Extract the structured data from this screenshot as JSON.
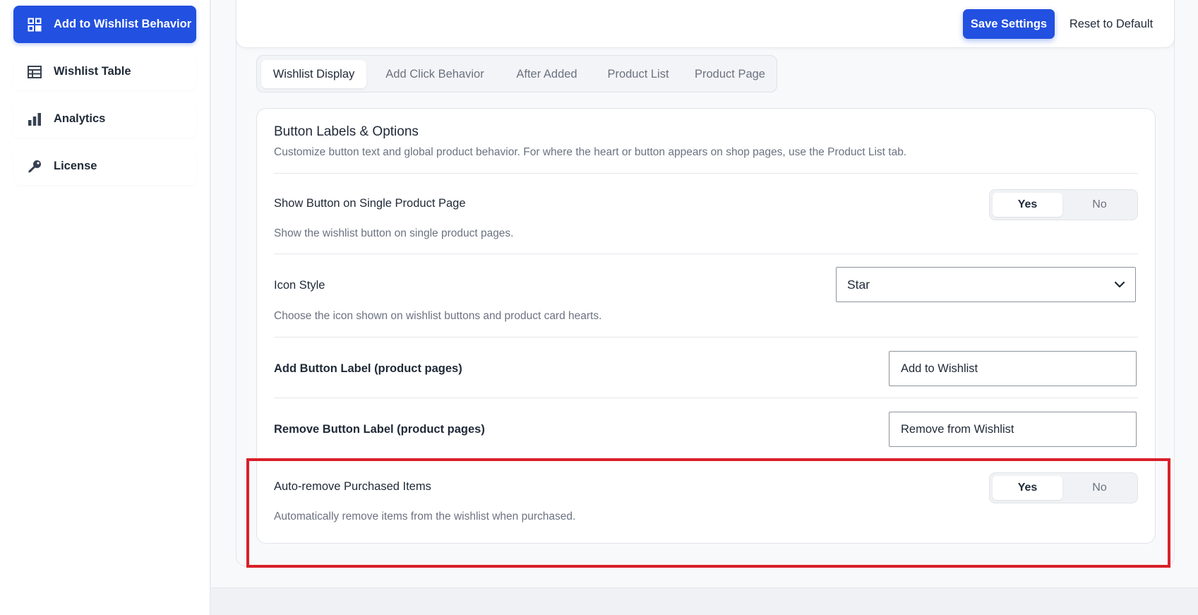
{
  "sidebar": {
    "items": [
      {
        "label": "Add to Wishlist Behavior",
        "icon": "grid-icon",
        "active": true
      },
      {
        "label": "Wishlist Table",
        "icon": "table-icon",
        "active": false
      },
      {
        "label": "Analytics",
        "icon": "bar-chart-icon",
        "active": false
      },
      {
        "label": "License",
        "icon": "key-icon",
        "active": false
      }
    ]
  },
  "toolbar": {
    "save_label": "Save Settings",
    "reset_label": "Reset to Default"
  },
  "tabs": [
    {
      "label": "Wishlist Display",
      "active": true
    },
    {
      "label": "Add Click Behavior",
      "active": false
    },
    {
      "label": "After Added",
      "active": false
    },
    {
      "label": "Product List",
      "active": false
    },
    {
      "label": "Product Page",
      "active": false
    }
  ],
  "section": {
    "title": "Button Labels & Options",
    "description": "Customize button text and global product behavior. For where the heart or button appears on shop pages, use the Product List tab."
  },
  "settings": {
    "show_button": {
      "label": "Show Button on Single Product Page",
      "description": "Show the wishlist button on single product pages.",
      "yes": "Yes",
      "no": "No",
      "value": "Yes"
    },
    "icon_style": {
      "label": "Icon Style",
      "description": "Choose the icon shown on wishlist buttons and product card hearts.",
      "value": "Star"
    },
    "add_label": {
      "label": "Add Button Label (product pages)",
      "value": "Add to Wishlist"
    },
    "remove_label": {
      "label": "Remove Button Label (product pages)",
      "value": "Remove from Wishlist"
    },
    "auto_remove": {
      "label": "Auto-remove Purchased Items",
      "description": "Automatically remove items from the wishlist when purchased.",
      "yes": "Yes",
      "no": "No",
      "value": "Yes"
    }
  },
  "colors": {
    "accent": "#2250e0",
    "highlight": "#d9202a"
  }
}
